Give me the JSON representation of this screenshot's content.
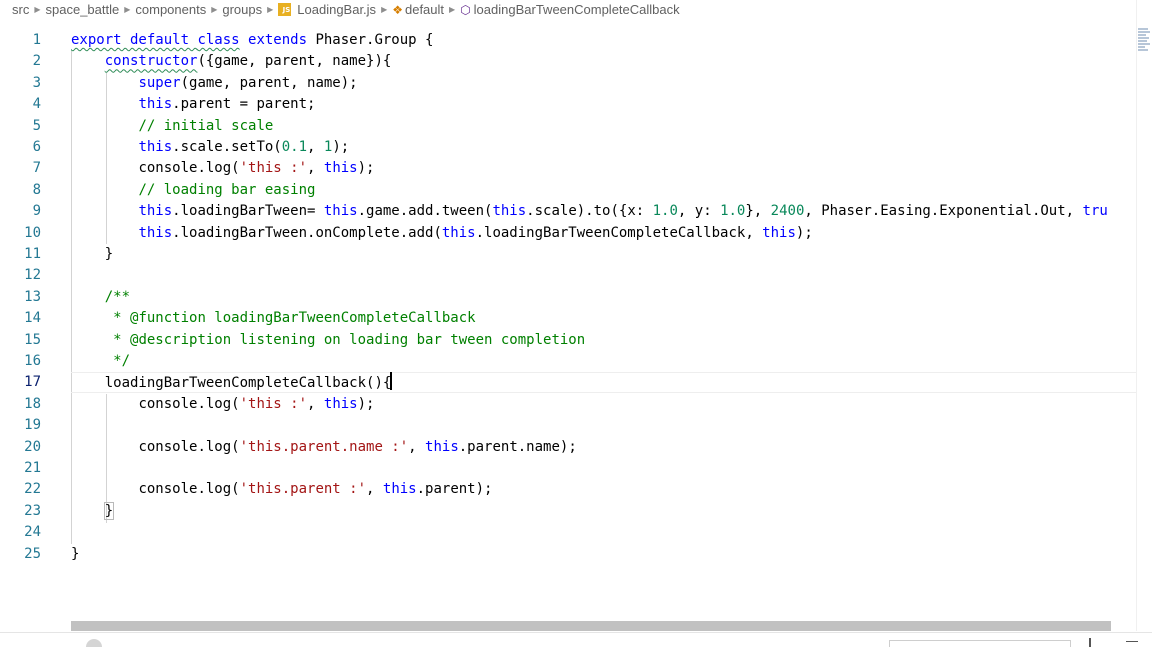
{
  "breadcrumb": {
    "items": [
      "src",
      "space_battle",
      "components",
      "groups",
      "LoadingBar.js",
      "default",
      "loadingBarTweenCompleteCallback"
    ],
    "file_badge": "JS"
  },
  "editor": {
    "active_line": 17,
    "lines": [
      {
        "n": "1",
        "tokens": [
          {
            "t": "export default ",
            "c": "kw",
            "sq": true
          },
          {
            "t": "class",
            "c": "kw",
            "sq": true
          },
          {
            "t": " extends ",
            "c": "kw"
          },
          {
            "t": "Phaser.Group {",
            "c": ""
          }
        ]
      },
      {
        "n": "2",
        "tokens": [
          {
            "t": "    ",
            "c": ""
          },
          {
            "t": "constructor",
            "c": "kw",
            "sq": true
          },
          {
            "t": "({game, parent, name}){",
            "c": ""
          }
        ]
      },
      {
        "n": "3",
        "tokens": [
          {
            "t": "        ",
            "c": ""
          },
          {
            "t": "super",
            "c": "kw"
          },
          {
            "t": "(game, parent, name);",
            "c": ""
          }
        ]
      },
      {
        "n": "4",
        "tokens": [
          {
            "t": "        ",
            "c": ""
          },
          {
            "t": "this",
            "c": "kw"
          },
          {
            "t": ".parent = parent;",
            "c": ""
          }
        ]
      },
      {
        "n": "5",
        "tokens": [
          {
            "t": "        ",
            "c": ""
          },
          {
            "t": "// initial scale",
            "c": "cmt"
          }
        ]
      },
      {
        "n": "6",
        "tokens": [
          {
            "t": "        ",
            "c": ""
          },
          {
            "t": "this",
            "c": "kw"
          },
          {
            "t": ".scale.setTo(",
            "c": ""
          },
          {
            "t": "0.1",
            "c": "num"
          },
          {
            "t": ", ",
            "c": ""
          },
          {
            "t": "1",
            "c": "num"
          },
          {
            "t": ");",
            "c": ""
          }
        ]
      },
      {
        "n": "7",
        "tokens": [
          {
            "t": "        ",
            "c": ""
          },
          {
            "t": "console.log(",
            "c": ""
          },
          {
            "t": "'this :'",
            "c": "str"
          },
          {
            "t": ", ",
            "c": ""
          },
          {
            "t": "this",
            "c": "kw"
          },
          {
            "t": ");",
            "c": ""
          }
        ]
      },
      {
        "n": "8",
        "tokens": [
          {
            "t": "        ",
            "c": ""
          },
          {
            "t": "// loading bar easing",
            "c": "cmt"
          }
        ]
      },
      {
        "n": "9",
        "tokens": [
          {
            "t": "        ",
            "c": ""
          },
          {
            "t": "this",
            "c": "kw"
          },
          {
            "t": ".loadingBarTween= ",
            "c": ""
          },
          {
            "t": "this",
            "c": "kw"
          },
          {
            "t": ".game.add.tween(",
            "c": ""
          },
          {
            "t": "this",
            "c": "kw"
          },
          {
            "t": ".scale).to({x: ",
            "c": ""
          },
          {
            "t": "1.0",
            "c": "num"
          },
          {
            "t": ", y: ",
            "c": ""
          },
          {
            "t": "1.0",
            "c": "num"
          },
          {
            "t": "}, ",
            "c": ""
          },
          {
            "t": "2400",
            "c": "num"
          },
          {
            "t": ", Phaser.Easing.Exponential.Out, ",
            "c": ""
          },
          {
            "t": "tru",
            "c": "kw"
          }
        ]
      },
      {
        "n": "10",
        "tokens": [
          {
            "t": "        ",
            "c": ""
          },
          {
            "t": "this",
            "c": "kw"
          },
          {
            "t": ".loadingBarTween.onComplete.add(",
            "c": ""
          },
          {
            "t": "this",
            "c": "kw"
          },
          {
            "t": ".loadingBarTweenCompleteCallback, ",
            "c": ""
          },
          {
            "t": "this",
            "c": "kw"
          },
          {
            "t": ");",
            "c": ""
          }
        ]
      },
      {
        "n": "11",
        "tokens": [
          {
            "t": "    }",
            "c": ""
          }
        ]
      },
      {
        "n": "12",
        "tokens": []
      },
      {
        "n": "13",
        "tokens": [
          {
            "t": "    ",
            "c": ""
          },
          {
            "t": "/**",
            "c": "cmt"
          }
        ]
      },
      {
        "n": "14",
        "tokens": [
          {
            "t": "     ",
            "c": ""
          },
          {
            "t": "* @function loadingBarTweenCompleteCallback",
            "c": "cmt"
          }
        ]
      },
      {
        "n": "15",
        "tokens": [
          {
            "t": "     ",
            "c": ""
          },
          {
            "t": "* @description listening on loading bar tween completion",
            "c": "cmt"
          }
        ]
      },
      {
        "n": "16",
        "tokens": [
          {
            "t": "     ",
            "c": ""
          },
          {
            "t": "*/",
            "c": "cmt"
          }
        ]
      },
      {
        "n": "17",
        "tokens": [
          {
            "t": "    ",
            "c": ""
          },
          {
            "t": "loadingBarTweenCompleteCallback(){",
            "c": ""
          }
        ],
        "cursor": true
      },
      {
        "n": "18",
        "tokens": [
          {
            "t": "        ",
            "c": ""
          },
          {
            "t": "console.log(",
            "c": ""
          },
          {
            "t": "'this :'",
            "c": "str"
          },
          {
            "t": ", ",
            "c": ""
          },
          {
            "t": "this",
            "c": "kw"
          },
          {
            "t": ");",
            "c": ""
          }
        ]
      },
      {
        "n": "19",
        "tokens": []
      },
      {
        "n": "20",
        "tokens": [
          {
            "t": "        ",
            "c": ""
          },
          {
            "t": "console.log(",
            "c": ""
          },
          {
            "t": "'this.parent.name :'",
            "c": "str"
          },
          {
            "t": ", ",
            "c": ""
          },
          {
            "t": "this",
            "c": "kw"
          },
          {
            "t": ".parent.name);",
            "c": ""
          }
        ]
      },
      {
        "n": "21",
        "tokens": []
      },
      {
        "n": "22",
        "tokens": [
          {
            "t": "        ",
            "c": ""
          },
          {
            "t": "console.log(",
            "c": ""
          },
          {
            "t": "'this.parent :'",
            "c": "str"
          },
          {
            "t": ", ",
            "c": ""
          },
          {
            "t": "this",
            "c": "kw"
          },
          {
            "t": ".parent);",
            "c": ""
          }
        ]
      },
      {
        "n": "23",
        "tokens": [
          {
            "t": "    ",
            "c": ""
          },
          {
            "t": "}",
            "c": "",
            "match": true
          }
        ]
      },
      {
        "n": "24",
        "tokens": []
      },
      {
        "n": "25",
        "tokens": [
          {
            "t": "}",
            "c": ""
          }
        ]
      }
    ]
  },
  "colors": {
    "keyword": "#0000ff",
    "string": "#a31515",
    "number": "#09885a",
    "comment": "#008000",
    "line_number": "#237893"
  }
}
